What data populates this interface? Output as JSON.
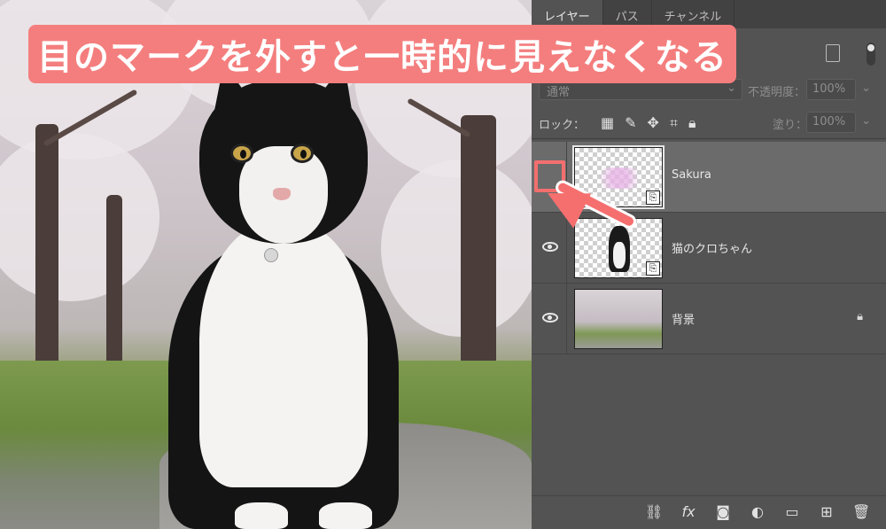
{
  "annotation": {
    "headline": "目のマークを外すと一時的に見えなくなる"
  },
  "panel": {
    "tabs": [
      {
        "label": "レイヤー",
        "active": true
      },
      {
        "label": "パス",
        "active": false
      },
      {
        "label": "チャンネル",
        "active": false
      }
    ],
    "blend_mode": "通常",
    "opacity_label": "不透明度：",
    "opacity_value": "100%",
    "lock_label": "ロック：",
    "fill_label": "塗り：",
    "fill_value": "100%",
    "layers": [
      {
        "name": "Sakura",
        "visible": false,
        "selected": true,
        "smart_object": true,
        "locked": false
      },
      {
        "name": "猫のクロちゃん",
        "visible": true,
        "selected": false,
        "smart_object": true,
        "locked": false
      },
      {
        "name": "背景",
        "visible": true,
        "selected": false,
        "smart_object": false,
        "locked": true
      }
    ],
    "bottom_icons": [
      "link-icon",
      "fx-icon",
      "mask-icon",
      "adjustment-icon",
      "folder-icon",
      "new-layer-icon",
      "trash-icon"
    ]
  },
  "colors": {
    "accent": "#f47e7e",
    "panel_bg": "#535353",
    "selected_layer_bg": "#6b6b6b"
  }
}
